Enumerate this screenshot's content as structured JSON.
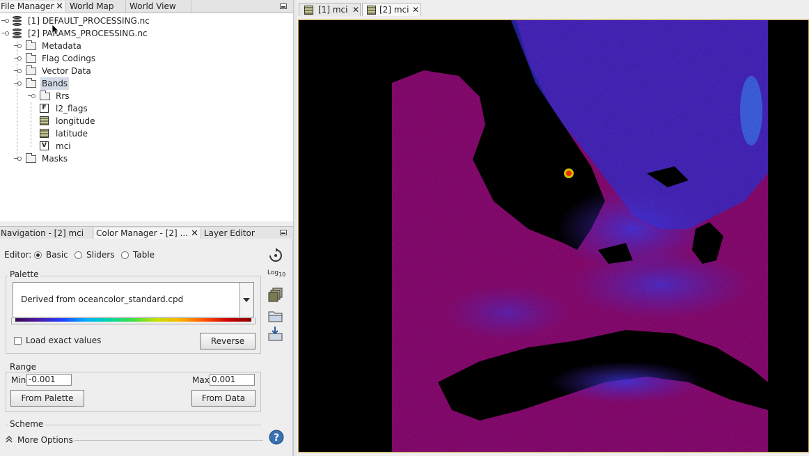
{
  "top_tabs": [
    {
      "label": "File Manager"
    },
    {
      "label": "World Map"
    },
    {
      "label": "World View"
    }
  ],
  "tree": {
    "products": [
      {
        "label": "[1] DEFAULT_PROCESSING.nc"
      },
      {
        "label": "[2] PARAMS_PROCESSING.nc"
      }
    ],
    "groups": {
      "metadata": "Metadata",
      "flag_codings": "Flag Codings",
      "vector_data": "Vector Data",
      "bands": "Bands",
      "masks": "Masks"
    },
    "bands": [
      {
        "label": "Rrs",
        "icon": "folder-icon"
      },
      {
        "label": "l2_flags",
        "icon": "flag-band-icon",
        "glyph": "F"
      },
      {
        "label": "longitude",
        "icon": "band-icon"
      },
      {
        "label": "latitude",
        "icon": "band-icon"
      },
      {
        "label": "mci",
        "icon": "virtual-band-icon",
        "glyph": "V"
      }
    ]
  },
  "bottom_tabs": [
    {
      "label": "Navigation - [2] mci"
    },
    {
      "label": "Color Manager - [2] ..."
    },
    {
      "label": "Layer Editor"
    }
  ],
  "color_manager": {
    "editor_label": "Editor:",
    "editor_options": [
      "Basic",
      "Sliders",
      "Table"
    ],
    "editor_selected": "Basic",
    "palette_title": "Palette",
    "palette_value": "Derived from oceancolor_standard.cpd",
    "load_exact_label": "Load exact values",
    "reverse_label": "Reverse",
    "range_title": "Range",
    "min_label": "Min:",
    "min_value": "-0.001",
    "max_label": "Max:",
    "max_value": "0.001",
    "from_palette_label": "From Palette",
    "from_data_label": "From Data",
    "scheme_title": "Scheme",
    "more_options_label": "More Options",
    "log_label": "Log",
    "log_sub": "10"
  },
  "image_tabs": [
    {
      "label": "[1] mci"
    },
    {
      "label": "[2] mci"
    }
  ],
  "colors": {
    "land_magenta": "#8a0a72",
    "water_blue": "#3a3ae8",
    "background": "#000000",
    "selection": "#d3dbe6"
  }
}
